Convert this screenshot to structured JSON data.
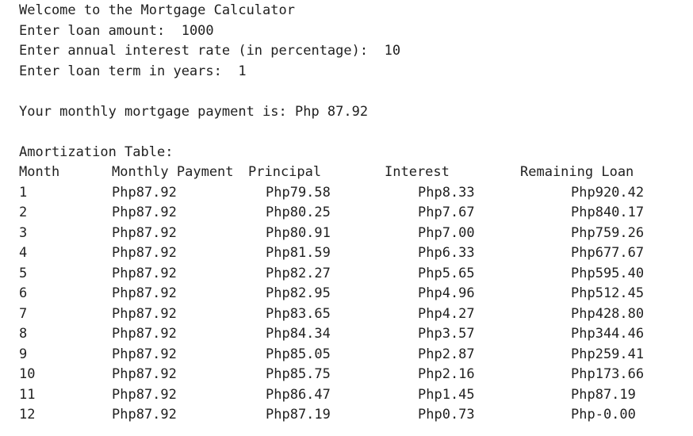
{
  "console": {
    "welcome": "Welcome to the Mortgage Calculator",
    "prompt_amount_label": "Enter loan amount:  ",
    "prompt_amount_value": "1000",
    "prompt_rate_label": "Enter annual interest rate (in percentage):  ",
    "prompt_rate_value": "10",
    "prompt_term_label": "Enter loan term in years:  ",
    "prompt_term_value": "1",
    "result": "Your monthly mortgage payment is: Php 87.92",
    "table_title": "Amortization Table:"
  },
  "table": {
    "headers": [
      "Month",
      "Monthly Payment",
      "Principal",
      "Interest",
      "Remaining Loan"
    ],
    "rows": [
      [
        "1",
        "Php87.92",
        "Php79.58",
        "Php8.33",
        "Php920.42"
      ],
      [
        "2",
        "Php87.92",
        "Php80.25",
        "Php7.67",
        "Php840.17"
      ],
      [
        "3",
        "Php87.92",
        "Php80.91",
        "Php7.00",
        "Php759.26"
      ],
      [
        "4",
        "Php87.92",
        "Php81.59",
        "Php6.33",
        "Php677.67"
      ],
      [
        "5",
        "Php87.92",
        "Php82.27",
        "Php5.65",
        "Php595.40"
      ],
      [
        "6",
        "Php87.92",
        "Php82.95",
        "Php4.96",
        "Php512.45"
      ],
      [
        "7",
        "Php87.92",
        "Php83.65",
        "Php4.27",
        "Php428.80"
      ],
      [
        "8",
        "Php87.92",
        "Php84.34",
        "Php3.57",
        "Php344.46"
      ],
      [
        "9",
        "Php87.92",
        "Php85.05",
        "Php2.87",
        "Php259.41"
      ],
      [
        "10",
        "Php87.92",
        "Php85.75",
        "Php2.16",
        "Php173.66"
      ],
      [
        "11",
        "Php87.92",
        "Php86.47",
        "Php1.45",
        "Php87.19"
      ],
      [
        "12",
        "Php87.92",
        "Php87.19",
        "Php0.73",
        "Php-0.00"
      ]
    ]
  }
}
